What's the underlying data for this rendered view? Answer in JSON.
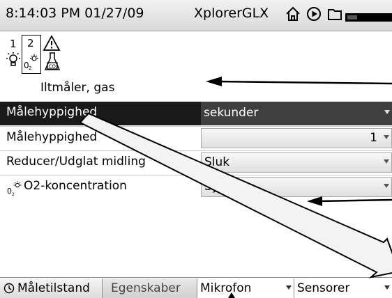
{
  "status_bar": {
    "datetime": "8:14:03 PM  01/27/09",
    "app_title": "XplorerGLX",
    "icons": [
      "home-icon",
      "play-circle-icon",
      "folder-icon",
      "battery-icon"
    ]
  },
  "sensor_strip": {
    "channel_1": "1",
    "channel_2": "2",
    "icons": [
      "light-bulb-icon",
      "oxygen-sensor-icon",
      "warning-icon",
      "co2-flask-icon"
    ],
    "sensor_name": "Iltmåler, gas"
  },
  "settings": [
    {
      "label": "Målehyppighed",
      "value": "sekunder",
      "selected": true
    },
    {
      "label": "Målehyppighed",
      "value": "1",
      "selected": false
    },
    {
      "label": "Reducer/Udglat midling",
      "value": "Sluk",
      "selected": false
    },
    {
      "label": "O2-koncentration",
      "value": "Synlig",
      "selected": false,
      "icon": "o2-sensor-icon"
    }
  ],
  "tabs": [
    {
      "label": "Måletilstand",
      "icon": "clock-icon"
    },
    {
      "label": "Egenskaber"
    },
    {
      "label": "Mikrofon",
      "dropdown": true
    },
    {
      "label": "Sensorer",
      "dropdown": true
    }
  ],
  "annotations": [
    "arrow-to-sensor-name",
    "arrow-to-o2-value",
    "arrow-diagonal-to-bottom-right",
    "arrow-to-mikrofon-tab"
  ],
  "colors": {
    "selected_row": "#1a1a1a",
    "selected_value_bg": "#3f3f3f",
    "field_bg": "#e8e8e8"
  }
}
